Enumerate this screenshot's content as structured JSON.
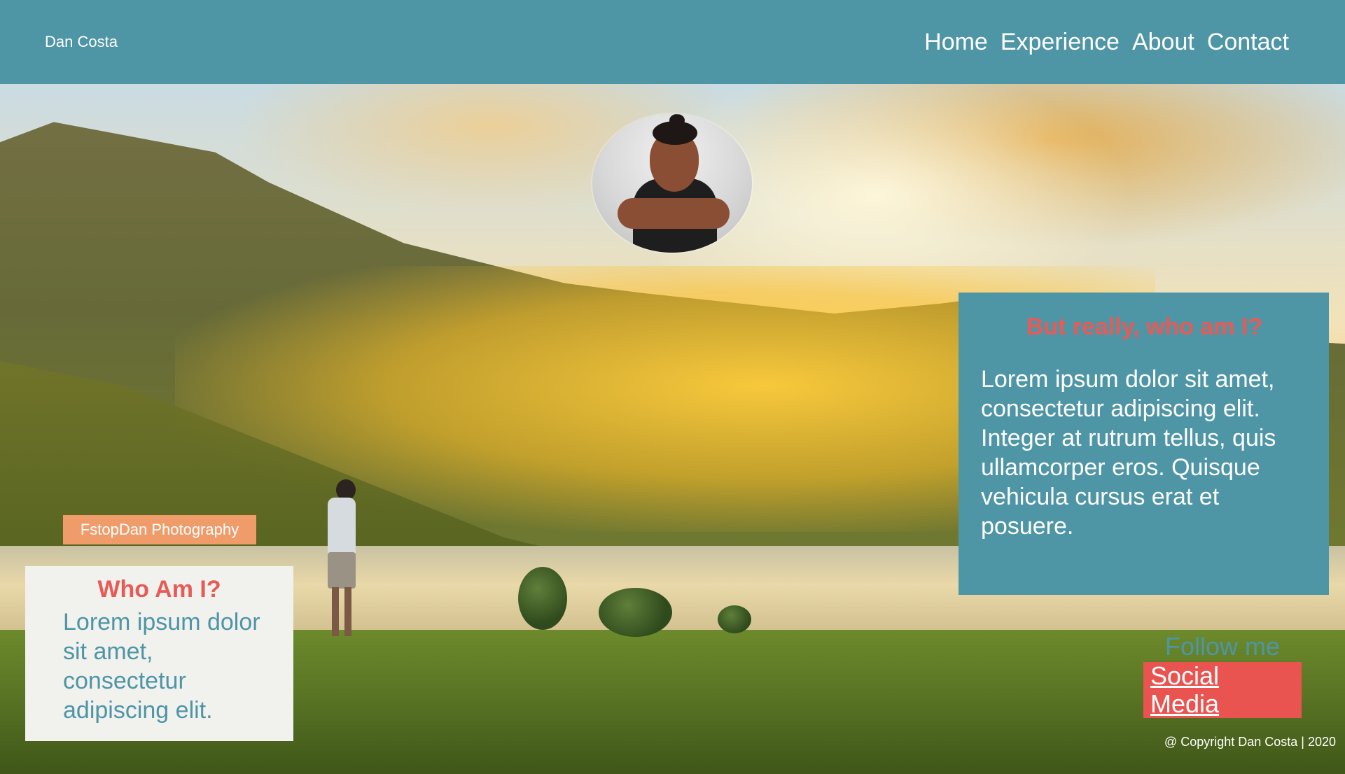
{
  "header": {
    "brand": "Dan Costa",
    "nav": [
      "Home",
      "Experience",
      "About",
      "Contact"
    ]
  },
  "hero": {
    "tag": "FstopDan Photography"
  },
  "who_card": {
    "title": "Who Am I?",
    "text": "Lorem ipsum dolor sit amet, consectetur adipiscing elit."
  },
  "info_card": {
    "title": "But really, who am I?",
    "text": "Lorem ipsum dolor sit amet, consectetur adipiscing elit. Integer at rutrum tellus, quis ullamcorper eros. Quisque vehicula cursus erat et posuere."
  },
  "follow": {
    "label": "Follow me",
    "button": "Social Media"
  },
  "footer": {
    "copyright": "@ Copyright Dan Costa | 2020"
  },
  "colors": {
    "primary": "#4e95a6",
    "accent": "#e75b57",
    "tag": "#ef9c6a",
    "card_light": "#f1f1ee"
  }
}
